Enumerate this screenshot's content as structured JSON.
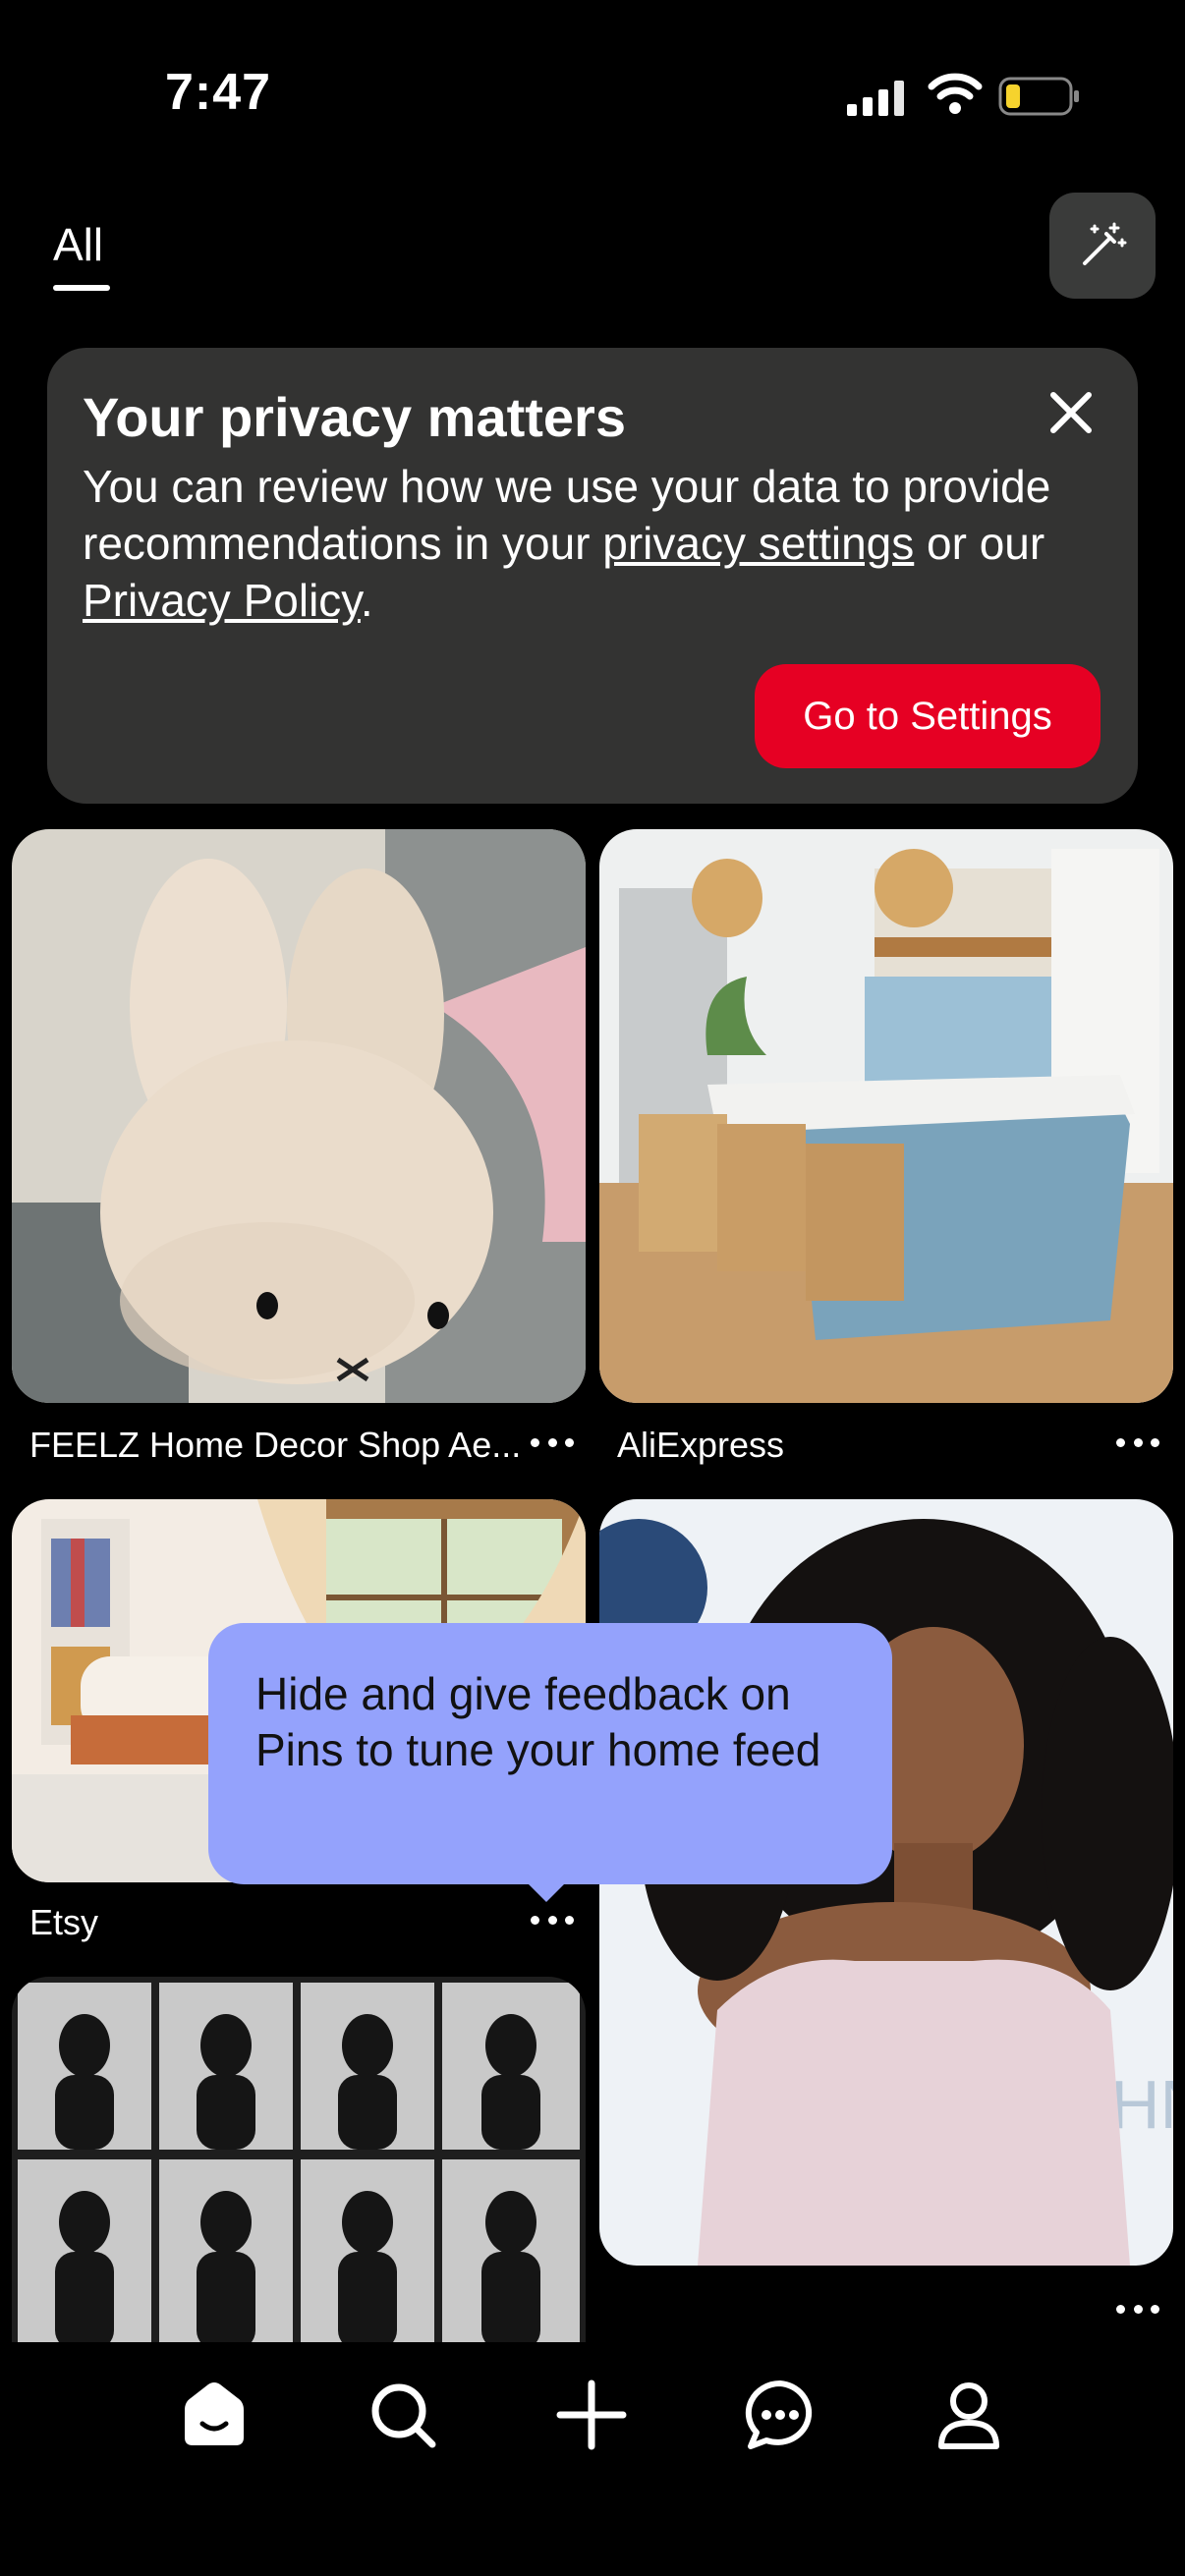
{
  "status_bar": {
    "time": "7:47"
  },
  "top_tabs": {
    "active_tab": "All"
  },
  "privacy_card": {
    "title": "Your privacy matters",
    "body_1": "You can review how we use your data to provide recommendations in your ",
    "link_1": "privacy settings",
    "body_2": " or our ",
    "link_2": "Privacy Policy",
    "body_3": ".",
    "button_label": "Go to Settings"
  },
  "pins": [
    {
      "label": "FEELZ Home Decor Shop Ae...",
      "image": "beige bunny plush pillow"
    },
    {
      "label": "AliExpress",
      "image": "coastal kitchen with blue island and wicker stools"
    },
    {
      "label": "Etsy",
      "image": "bright nook with bookshelves and curtains"
    },
    {
      "label": "",
      "image": "woman with curly hair on red carpet"
    },
    {
      "label": "",
      "image": "black and white contact sheet of portraits"
    }
  ],
  "tooltip": {
    "text": "Hide and give feedback on Pins to tune your home feed"
  },
  "nav": {
    "items": [
      "home-icon",
      "search-icon",
      "create-plus-icon",
      "messages-icon",
      "profile-icon"
    ]
  },
  "colors": {
    "accent_red": "#e60023",
    "card_bg": "#333332",
    "tooltip_bg": "#94a2fc"
  }
}
